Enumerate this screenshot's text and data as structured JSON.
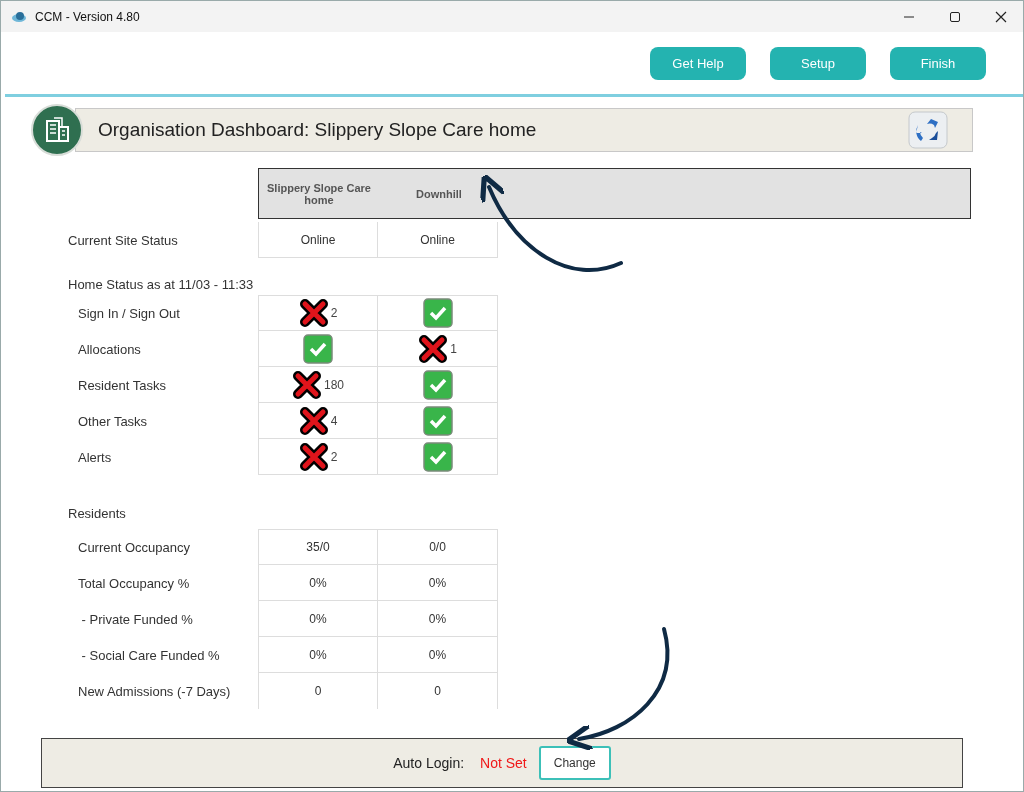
{
  "window": {
    "title": "CCM - Version 4.80"
  },
  "toolbar": {
    "buttons": [
      "Get Help",
      "Setup",
      "Finish"
    ]
  },
  "dashboard": {
    "title": "Organisation Dashboard: Slippery Slope Care home"
  },
  "sites": [
    "Slippery Slope Care home",
    "Downhill"
  ],
  "site_status": {
    "label": "Current Site Status",
    "values": [
      "Online",
      "Online"
    ]
  },
  "home_status": {
    "heading": "Home Status as at 11/03 - 11:33",
    "rows": [
      {
        "label": "Sign In / Sign Out",
        "cells": [
          {
            "ok": false,
            "count": "2"
          },
          {
            "ok": true
          }
        ]
      },
      {
        "label": "Allocations",
        "cells": [
          {
            "ok": true
          },
          {
            "ok": false,
            "count": "1"
          }
        ]
      },
      {
        "label": "Resident Tasks",
        "cells": [
          {
            "ok": false,
            "count": "180"
          },
          {
            "ok": true
          }
        ]
      },
      {
        "label": "Other Tasks",
        "cells": [
          {
            "ok": false,
            "count": "4"
          },
          {
            "ok": true
          }
        ]
      },
      {
        "label": "Alerts",
        "cells": [
          {
            "ok": false,
            "count": "2"
          },
          {
            "ok": true
          }
        ]
      }
    ]
  },
  "residents": {
    "heading": "Residents",
    "rows": [
      {
        "label": "Current Occupancy",
        "values": [
          "35/0",
          "0/0"
        ]
      },
      {
        "label": "Total Occupancy %",
        "values": [
          "0%",
          "0%"
        ]
      },
      {
        "label": " - Private Funded %",
        "values": [
          "0%",
          "0%"
        ]
      },
      {
        "label": " - Social Care Funded %",
        "values": [
          "0%",
          "0%"
        ]
      },
      {
        "label": "New Admissions (-7 Days)",
        "values": [
          "0",
          "0"
        ]
      }
    ]
  },
  "auto_login": {
    "label": "Auto Login:",
    "status": "Not Set",
    "set": false,
    "button": "Change"
  }
}
